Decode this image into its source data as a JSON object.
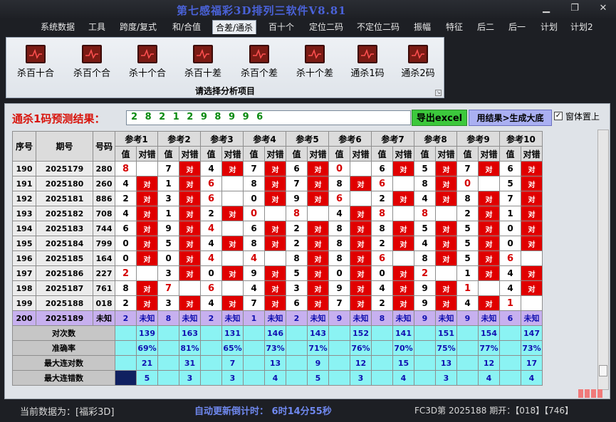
{
  "window": {
    "title": "第七感福彩3D排列三软件V8.81"
  },
  "menu": [
    "系统数据",
    "工具",
    "跨度/复式",
    "和/合值",
    "合差/通杀",
    "百十个",
    "定位二码",
    "不定位二码",
    "振幅",
    "特征",
    "后二",
    "后一",
    "计划",
    "计划2"
  ],
  "ribbon": {
    "buttons": [
      "杀百十合",
      "杀百个合",
      "杀十个合",
      "杀百十差",
      "杀百个差",
      "杀十个差",
      "通杀1码",
      "通杀2码"
    ],
    "caption": "请选择分析项目"
  },
  "prediction": {
    "label": "通杀1码预测结果：",
    "value": "2 8 2 1 2 9 8 9 9 6",
    "export_button": "导出excel",
    "generate_button": "用结果>生成大底",
    "checkbox_label": "窗体置上",
    "checkbox_mark": "✓"
  },
  "table": {
    "headers": {
      "seq": "序号",
      "period": "期号",
      "number": "号码"
    },
    "ref_headers": [
      "参考1",
      "参考2",
      "参考3",
      "参考4",
      "参考5",
      "参考6",
      "参考7",
      "参考8",
      "参考9",
      "参考10"
    ],
    "sub_value": "值",
    "sub_result": "对错",
    "hit_text": "对",
    "rows": [
      {
        "seq": "190",
        "period": "2025179",
        "number": "280",
        "vals": [
          "8",
          "7",
          "4",
          "7",
          "6",
          "0",
          "6",
          "5",
          "7",
          "6"
        ],
        "hits": [
          0,
          1,
          1,
          1,
          1,
          0,
          1,
          1,
          1,
          1
        ],
        "red": [
          1,
          0,
          0,
          0,
          0,
          1,
          0,
          0,
          0,
          0
        ]
      },
      {
        "seq": "191",
        "period": "2025180",
        "number": "260",
        "vals": [
          "4",
          "1",
          "6",
          "8",
          "7",
          "8",
          "6",
          "8",
          "0",
          "5"
        ],
        "hits": [
          1,
          1,
          0,
          1,
          1,
          1,
          0,
          1,
          0,
          1
        ],
        "red": [
          0,
          0,
          1,
          0,
          0,
          0,
          1,
          0,
          1,
          0
        ]
      },
      {
        "seq": "192",
        "period": "2025181",
        "number": "886",
        "vals": [
          "2",
          "3",
          "6",
          "0",
          "9",
          "6",
          "2",
          "4",
          "8",
          "7"
        ],
        "hits": [
          1,
          1,
          0,
          1,
          1,
          0,
          1,
          1,
          1,
          1
        ],
        "red": [
          0,
          0,
          1,
          0,
          0,
          1,
          0,
          0,
          0,
          0
        ]
      },
      {
        "seq": "193",
        "period": "2025182",
        "number": "708",
        "vals": [
          "4",
          "1",
          "2",
          "0",
          "8",
          "4",
          "8",
          "8",
          "2",
          "1"
        ],
        "hits": [
          1,
          1,
          1,
          0,
          0,
          1,
          0,
          0,
          1,
          1
        ],
        "red": [
          0,
          0,
          0,
          1,
          1,
          0,
          1,
          1,
          0,
          0
        ]
      },
      {
        "seq": "194",
        "period": "2025183",
        "number": "744",
        "vals": [
          "6",
          "9",
          "4",
          "6",
          "2",
          "8",
          "8",
          "5",
          "5",
          "0"
        ],
        "hits": [
          1,
          1,
          0,
          1,
          1,
          1,
          1,
          1,
          1,
          1
        ],
        "red": [
          0,
          0,
          1,
          0,
          0,
          0,
          0,
          0,
          0,
          0
        ]
      },
      {
        "seq": "195",
        "period": "2025184",
        "number": "799",
        "vals": [
          "0",
          "5",
          "4",
          "8",
          "2",
          "8",
          "2",
          "4",
          "5",
          "0"
        ],
        "hits": [
          1,
          1,
          1,
          1,
          1,
          1,
          1,
          1,
          1,
          1
        ],
        "red": [
          0,
          0,
          0,
          0,
          0,
          0,
          0,
          0,
          0,
          0
        ]
      },
      {
        "seq": "196",
        "period": "2025185",
        "number": "164",
        "vals": [
          "0",
          "0",
          "4",
          "4",
          "8",
          "8",
          "6",
          "8",
          "5",
          "6"
        ],
        "hits": [
          1,
          1,
          0,
          0,
          1,
          1,
          0,
          1,
          1,
          0
        ],
        "red": [
          0,
          0,
          1,
          1,
          0,
          0,
          1,
          0,
          0,
          1
        ]
      },
      {
        "seq": "197",
        "period": "2025186",
        "number": "227",
        "vals": [
          "2",
          "3",
          "0",
          "9",
          "5",
          "0",
          "0",
          "2",
          "1",
          "4"
        ],
        "hits": [
          0,
          1,
          1,
          1,
          1,
          1,
          1,
          0,
          1,
          1
        ],
        "red": [
          1,
          0,
          0,
          0,
          0,
          0,
          0,
          1,
          0,
          0
        ]
      },
      {
        "seq": "198",
        "period": "2025187",
        "number": "761",
        "vals": [
          "8",
          "7",
          "6",
          "4",
          "3",
          "9",
          "4",
          "9",
          "1",
          "4"
        ],
        "hits": [
          1,
          0,
          0,
          1,
          1,
          1,
          1,
          1,
          0,
          1
        ],
        "red": [
          0,
          1,
          1,
          0,
          0,
          0,
          0,
          0,
          1,
          0
        ]
      },
      {
        "seq": "199",
        "period": "2025188",
        "number": "018",
        "vals": [
          "2",
          "3",
          "4",
          "7",
          "6",
          "7",
          "2",
          "9",
          "4",
          "1"
        ],
        "hits": [
          1,
          1,
          1,
          1,
          1,
          1,
          1,
          1,
          1,
          0
        ],
        "red": [
          0,
          0,
          0,
          0,
          0,
          0,
          0,
          0,
          0,
          1
        ]
      }
    ],
    "unknown_row": {
      "seq": "200",
      "period": "2025189",
      "number": "未知",
      "vals": [
        "2",
        "8",
        "2",
        "1",
        "2",
        "9",
        "8",
        "9",
        "9",
        "6"
      ],
      "result": "未知"
    },
    "stats": [
      {
        "label": "对次数",
        "values": [
          "139",
          "163",
          "131",
          "146",
          "143",
          "152",
          "141",
          "151",
          "154",
          "147"
        ]
      },
      {
        "label": "准确率",
        "values": [
          "69%",
          "81%",
          "65%",
          "73%",
          "71%",
          "76%",
          "70%",
          "75%",
          "77%",
          "73%"
        ]
      },
      {
        "label": "最大连对数",
        "values": [
          "21",
          "31",
          "7",
          "13",
          "9",
          "12",
          "15",
          "13",
          "12",
          "17"
        ]
      },
      {
        "label": "最大连错数",
        "values": [
          "5",
          "3",
          "3",
          "4",
          "5",
          "3",
          "4",
          "3",
          "4",
          "4"
        ]
      }
    ]
  },
  "status": {
    "current_data": "当前数据为：[福彩3D]",
    "countdown": "自动更新倒计时：  6时14分55秒",
    "draw_info": "FC3D第 2025188 期开：【018】【746】"
  },
  "colors": {
    "hit": "#e00000",
    "unknown_row": "#c7b0ef",
    "stats_row": "#8bf3f3",
    "title": "#4a62d8",
    "prediction_label": "#d8140c"
  }
}
